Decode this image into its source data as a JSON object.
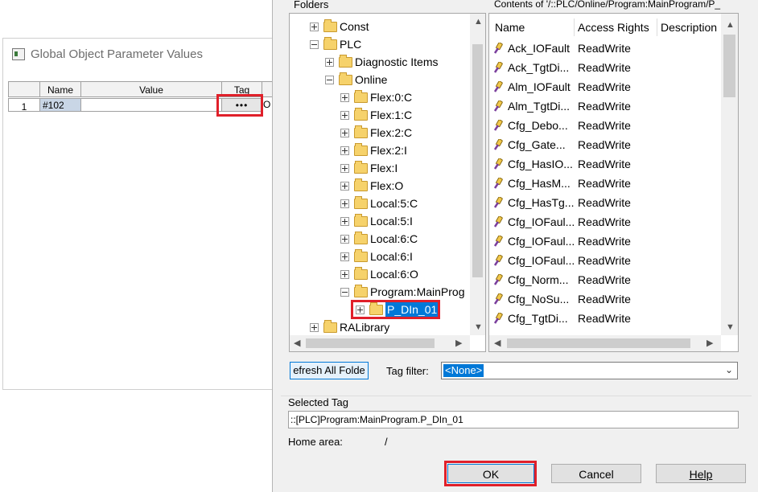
{
  "left_window": {
    "title": "Global Object Parameter Values",
    "table": {
      "headers": [
        "",
        "Name",
        "Value",
        "Tag",
        ""
      ],
      "row": {
        "index": "1",
        "name": "#102",
        "value": "",
        "tag_button": "•••",
        "extra": "O"
      }
    }
  },
  "dialog": {
    "folders_label": "Folders",
    "contents_label": "Contents of '/::PLC/Online/Program:MainProgram/P_",
    "tree": [
      {
        "label": "Const",
        "expander": "plus",
        "indent": 0
      },
      {
        "label": "PLC",
        "expander": "minus",
        "indent": 0
      },
      {
        "label": "Diagnostic Items",
        "expander": "plus",
        "indent": 1
      },
      {
        "label": "Online",
        "expander": "minus",
        "indent": 1
      },
      {
        "label": "Flex:0:C",
        "expander": "plus",
        "indent": 2
      },
      {
        "label": "Flex:1:C",
        "expander": "plus",
        "indent": 2
      },
      {
        "label": "Flex:2:C",
        "expander": "plus",
        "indent": 2
      },
      {
        "label": "Flex:2:I",
        "expander": "plus",
        "indent": 2
      },
      {
        "label": "Flex:I",
        "expander": "plus",
        "indent": 2
      },
      {
        "label": "Flex:O",
        "expander": "plus",
        "indent": 2
      },
      {
        "label": "Local:5:C",
        "expander": "plus",
        "indent": 2
      },
      {
        "label": "Local:5:I",
        "expander": "plus",
        "indent": 2
      },
      {
        "label": "Local:6:C",
        "expander": "plus",
        "indent": 2
      },
      {
        "label": "Local:6:I",
        "expander": "plus",
        "indent": 2
      },
      {
        "label": "Local:6:O",
        "expander": "plus",
        "indent": 2
      },
      {
        "label": "Program:MainProg",
        "expander": "minus",
        "indent": 2
      },
      {
        "label": "P_DIn_01",
        "expander": "plus",
        "indent": 3,
        "selected": true
      },
      {
        "label": "RALibrary",
        "expander": "plus",
        "indent": 0
      }
    ],
    "columns": [
      "Name",
      "Access Rights",
      "Description"
    ],
    "tags": [
      {
        "name": "Ack_IOFault",
        "access": "ReadWrite"
      },
      {
        "name": "Ack_TgtDi...",
        "access": "ReadWrite"
      },
      {
        "name": "Alm_IOFault",
        "access": "ReadWrite"
      },
      {
        "name": "Alm_TgtDi...",
        "access": "ReadWrite"
      },
      {
        "name": "Cfg_Debo...",
        "access": "ReadWrite"
      },
      {
        "name": "Cfg_Gate...",
        "access": "ReadWrite"
      },
      {
        "name": "Cfg_HasIO...",
        "access": "ReadWrite"
      },
      {
        "name": "Cfg_HasM...",
        "access": "ReadWrite"
      },
      {
        "name": "Cfg_HasTg...",
        "access": "ReadWrite"
      },
      {
        "name": "Cfg_IOFaul...",
        "access": "ReadWrite"
      },
      {
        "name": "Cfg_IOFaul...",
        "access": "ReadWrite"
      },
      {
        "name": "Cfg_IOFaul...",
        "access": "ReadWrite"
      },
      {
        "name": "Cfg_Norm...",
        "access": "ReadWrite"
      },
      {
        "name": "Cfg_NoSu...",
        "access": "ReadWrite"
      },
      {
        "name": "Cfg_TgtDi...",
        "access": "ReadWrite"
      }
    ],
    "refresh_label": "efresh All Folde",
    "tag_filter_label": "Tag filter:",
    "tag_filter_value": "<None>",
    "selected_tag_label": "Selected Tag",
    "selected_tag_value": "::[PLC]Program:MainProgram.P_DIn_01",
    "home_area_label": "Home area:",
    "home_area_value": "/",
    "ok_label": "OK",
    "cancel_label": "Cancel",
    "help_label": "Help"
  }
}
